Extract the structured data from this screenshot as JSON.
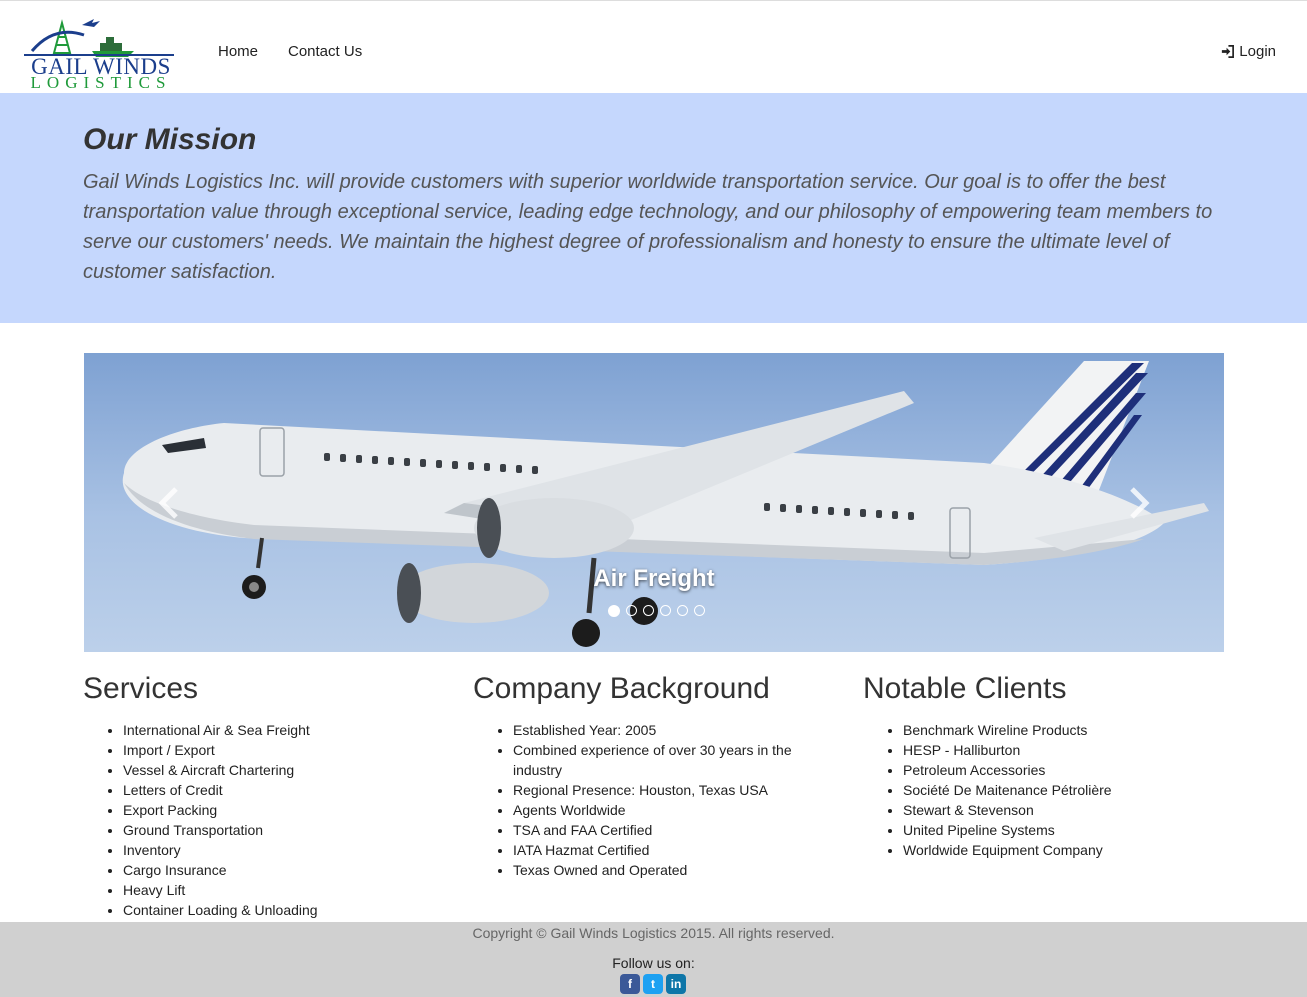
{
  "brand": {
    "line1": "GAIL WINDS",
    "line2": "LOGISTICS"
  },
  "nav": {
    "home": "Home",
    "contact": "Contact Us",
    "login": "Login"
  },
  "mission": {
    "title": "Our Mission",
    "text": "Gail Winds Logistics Inc. will provide customers with superior worldwide transportation service. Our goal is to offer the best transportation value through exceptional service, leading edge technology, and our philosophy of empowering team members to serve our customers' needs. We maintain the highest degree of professionalism and honesty to ensure the ultimate level of customer satisfaction."
  },
  "carousel": {
    "caption": "Air Freight",
    "slide_count": 6,
    "active_index": 0
  },
  "services": {
    "title": "Services",
    "items": [
      "International Air & Sea Freight",
      "Import / Export",
      "Vessel & Aircraft Chartering",
      "Letters of Credit",
      "Export Packing",
      "Ground Transportation",
      "Inventory",
      "Cargo Insurance",
      "Heavy Lift",
      "Container Loading & Unloading"
    ]
  },
  "background": {
    "title": "Company Background",
    "items": [
      "Established Year: 2005",
      "Combined experience of over 30 years in the industry",
      "Regional Presence: Houston, Texas USA",
      "Agents Worldwide",
      "TSA and FAA Certified",
      "IATA Hazmat Certified",
      "Texas Owned and Operated"
    ]
  },
  "clients": {
    "title": "Notable Clients",
    "items": [
      "Benchmark Wireline Products",
      "HESP - Halliburton",
      "Petroleum Accessories",
      "Société De Maitenance Pétrolière",
      "Stewart & Stevenson",
      "United Pipeline Systems",
      "Worldwide Equipment Company"
    ]
  },
  "footer": {
    "copyright": "Copyright © Gail Winds Logistics 2015. All rights reserved.",
    "follow": "Follow us on:",
    "social": [
      "f",
      "t",
      "in"
    ]
  },
  "colors": {
    "mission_bg": "#c5d7fd",
    "footer_bg": "#d0d0d0",
    "logo_blue": "#1b3e8c",
    "logo_green": "#1f9a3a"
  }
}
